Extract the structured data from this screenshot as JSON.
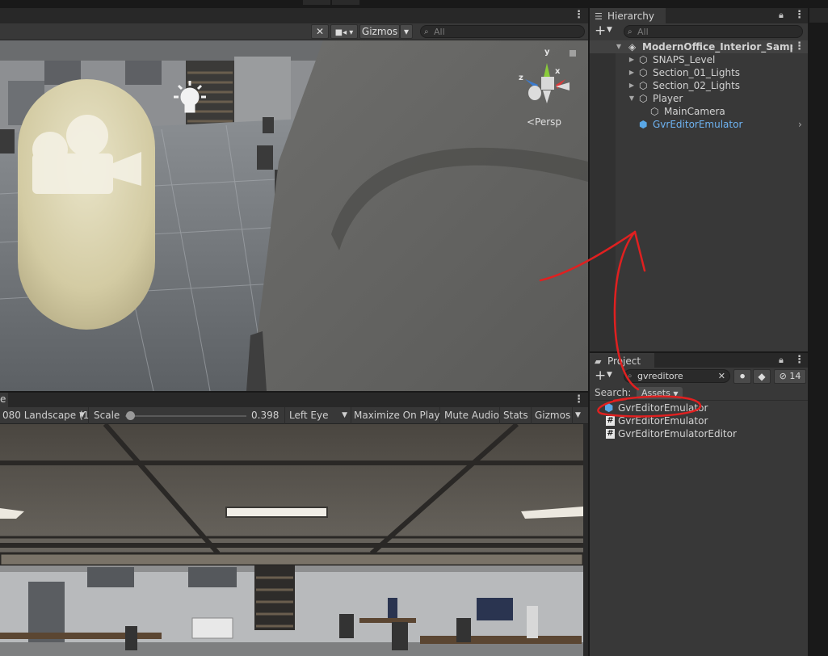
{
  "scene": {
    "gizmos_label": "Gizmos",
    "search_placeholder": "All",
    "persp_label": "<Persp",
    "axis_x": "x",
    "axis_y": "y",
    "axis_z": "z"
  },
  "game": {
    "tab_partial": "e",
    "resolution": "080 Landscape (1",
    "scale_label": "Scale",
    "scale_value": "0.398",
    "scale_fraction": 0.04,
    "eye": "Left Eye",
    "maximize_on_play": "Maximize On Play",
    "mute_audio": "Mute Audio",
    "stats": "Stats",
    "gizmos": "Gizmos"
  },
  "hierarchy": {
    "tab_label": "Hierarchy",
    "search_placeholder": "All",
    "scene_name": "ModernOffice_Interior_SampleL",
    "items": [
      {
        "label": "SNAPS_Level"
      },
      {
        "label": "Section_01_Lights"
      },
      {
        "label": "Section_02_Lights"
      },
      {
        "label": "Player"
      },
      {
        "label": "MainCamera"
      },
      {
        "label": "GvrEditorEmulator"
      }
    ]
  },
  "project": {
    "tab_label": "Project",
    "search_value": "gvreditore",
    "hidden_count": "14",
    "search_label": "Search:",
    "search_scope": "Assets",
    "results": [
      {
        "label": "GvrEditorEmulator"
      },
      {
        "label": "GvrEditorEmulator"
      },
      {
        "label": "GvrEditorEmulatorEditor"
      }
    ]
  },
  "colors": {
    "selected_text": "#6eb3f2",
    "annotation_red": "#e02020",
    "panel_bg": "#383838"
  }
}
